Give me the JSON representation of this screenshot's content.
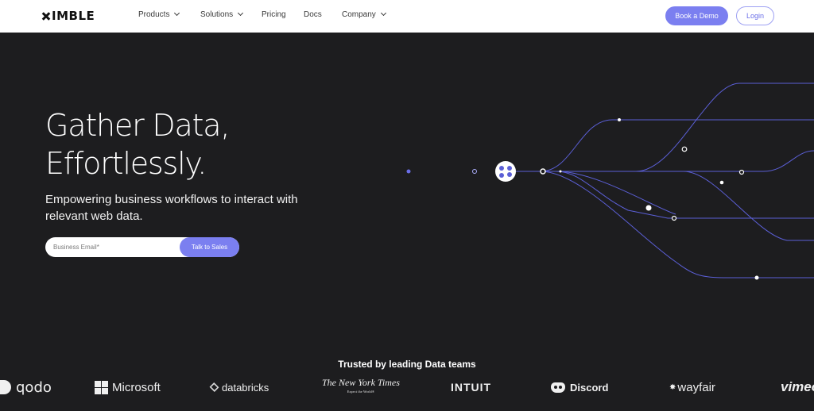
{
  "header": {
    "logo_text": "IMBLE",
    "nav": [
      {
        "label": "Products",
        "has_menu": true
      },
      {
        "label": "Solutions",
        "has_menu": true
      },
      {
        "label": "Pricing",
        "has_menu": false
      },
      {
        "label": "Docs",
        "has_menu": false
      },
      {
        "label": "Company",
        "has_menu": true
      }
    ],
    "book_demo": "Book a Demo",
    "login": "Login"
  },
  "hero": {
    "title_line1": "Gather Data,",
    "title_line2": "Effortlessly.",
    "subtitle": "Empowering business workflows to interact with relevant web data.",
    "email_placeholder": "Business Email*",
    "cta": "Talk to Sales"
  },
  "trusted": {
    "heading": "Trusted by leading Data teams",
    "logos": {
      "qodo": "qodo",
      "microsoft": "Microsoft",
      "databricks": "databricks",
      "nyt": "The New York Times",
      "nyt_tagline": "Expect the World®",
      "intuit": "INTUIT",
      "discord": "Discord",
      "wayfair": "wayfair",
      "vimeo": "vimeo"
    }
  },
  "colors": {
    "accent": "#7b7ff0",
    "background": "#1d1d1f",
    "header_bg": "#ffffff"
  }
}
